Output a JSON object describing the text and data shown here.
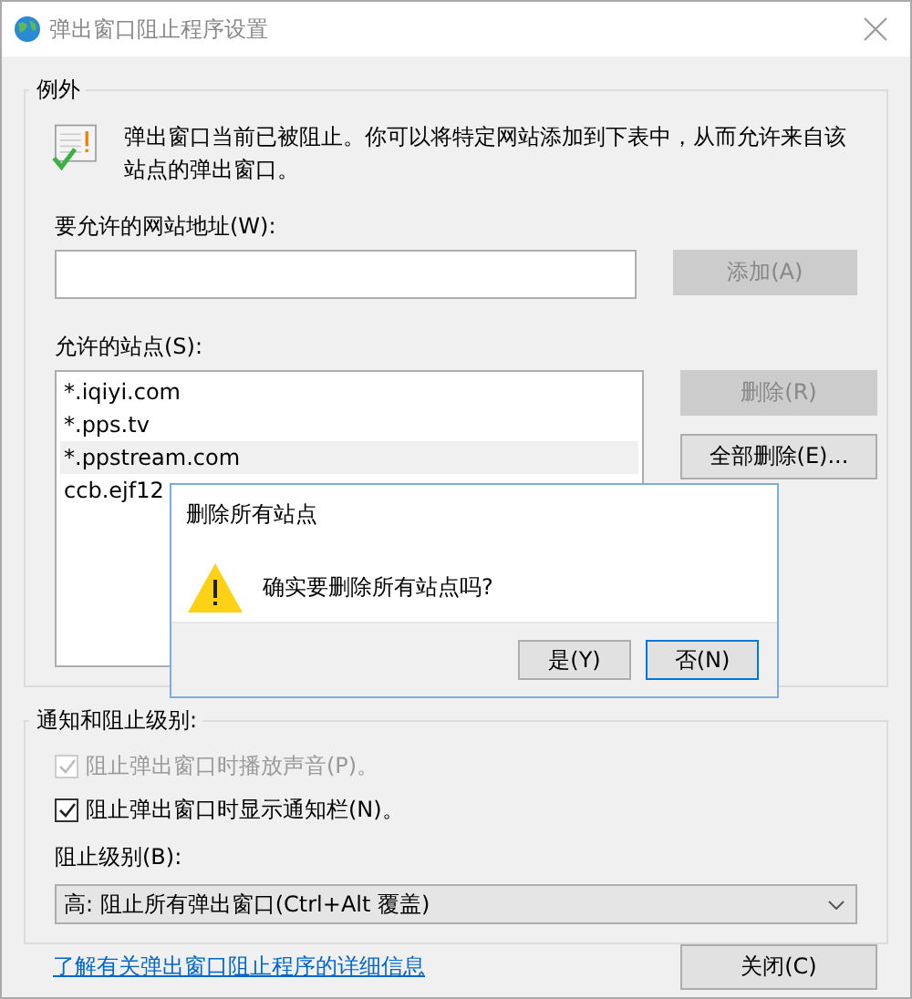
{
  "window": {
    "title": "弹出窗口阻止程序设置"
  },
  "exceptions": {
    "legend": "例外",
    "description": "弹出窗口当前已被阻止。你可以将特定网站添加到下表中，从而允许来自该站点的弹出窗口。",
    "address_label": "要允许的网站地址(W):",
    "add_button": {
      "label": "添加(A)",
      "disabled": true
    },
    "sites_label": "允许的站点(S):",
    "sites": [
      {
        "text": "*.iqiyi.com",
        "selected": false
      },
      {
        "text": "*.pps.tv",
        "selected": false
      },
      {
        "text": "*.ppstream.com",
        "selected": true
      },
      {
        "text": "ccb.ejf12",
        "selected": false
      }
    ],
    "remove_button": {
      "label": "删除(R)",
      "disabled": true
    },
    "remove_all_button": {
      "label": "全部删除(E)...",
      "disabled": false
    }
  },
  "notifications": {
    "legend": "通知和阻止级别:",
    "options": [
      {
        "label": "阻止弹出窗口时播放声音(P)。",
        "checked": true,
        "disabled": true
      },
      {
        "label": "阻止弹出窗口时显示通知栏(N)。",
        "checked": true,
        "disabled": false
      }
    ],
    "level_label": "阻止级别(B):",
    "level_select": {
      "value": "高: 阻止所有弹出窗口(Ctrl+Alt 覆盖)"
    }
  },
  "link": "了解有关弹出窗口阻止程序的详细信息",
  "close_button": {
    "label": "关闭(C)",
    "disabled": false
  },
  "dialog": {
    "title": "删除所有站点",
    "message": "确实要删除所有站点吗?",
    "buttons": [
      {
        "label": "是(Y)",
        "focused": false
      },
      {
        "label": "否(N)",
        "focused": true
      }
    ]
  }
}
